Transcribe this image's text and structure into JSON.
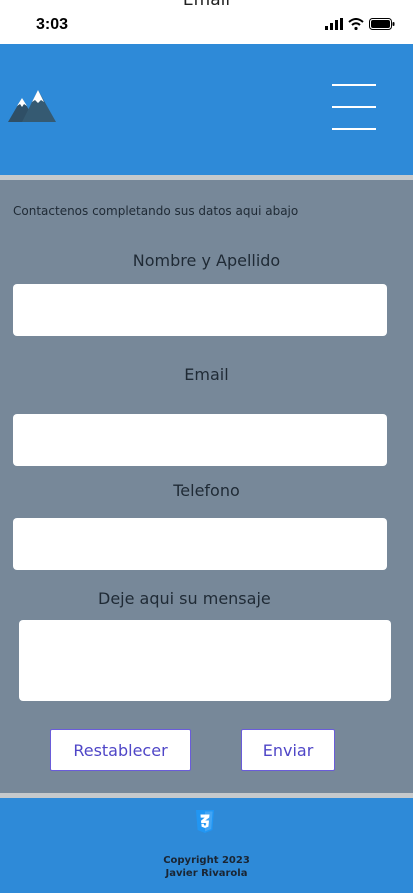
{
  "status_bar": {
    "overflow_text": "Email",
    "time": "3:03",
    "signal_icon": "cellular-signal-icon",
    "wifi_icon": "wifi-icon",
    "battery_icon": "battery-icon"
  },
  "header": {
    "logo_icon": "mountain-logo-icon",
    "menu_icon": "hamburger-menu-icon",
    "background_color": "#2e8ad8"
  },
  "form": {
    "intro": "Contactenos completando sus datos aqui abajo",
    "name_label": "Nombre y Apellido",
    "name_value": "",
    "email_label": "Email",
    "email_value": "",
    "phone_label": "Telefono",
    "phone_value": "",
    "message_label": "Deje aqui su mensaje",
    "message_value": "",
    "reset_label": "Restablecer",
    "submit_label": "Enviar",
    "background_color": "#778899"
  },
  "footer": {
    "css_icon": "css3-icon",
    "copyright_line1": "Copyright 2023",
    "copyright_line2": "Javier Rivarola"
  }
}
